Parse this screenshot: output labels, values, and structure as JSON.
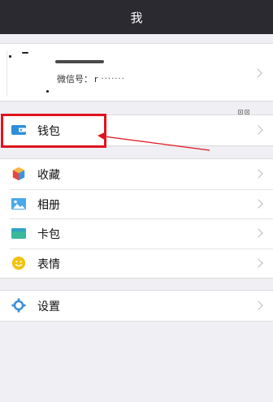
{
  "header": {
    "title": "我"
  },
  "profile": {
    "wechat_id_label": "微信号：",
    "wechat_id_value": "r",
    "wechat_id_masked": "·······"
  },
  "groups": [
    {
      "items": [
        {
          "label": "钱包",
          "icon": "wallet-icon"
        }
      ]
    },
    {
      "items": [
        {
          "label": "收藏",
          "icon": "favorites-cube-icon"
        },
        {
          "label": "相册",
          "icon": "album-picture-icon"
        },
        {
          "label": "卡包",
          "icon": "card-pack-icon"
        },
        {
          "label": "表情",
          "icon": "emoji-face-icon"
        }
      ]
    },
    {
      "items": [
        {
          "label": "设置",
          "icon": "settings-gear-icon"
        }
      ]
    }
  ],
  "colors": {
    "titlebar": "#2b2a30",
    "background": "#efeff4",
    "highlight": "#e0141e",
    "wallet": "#2f8fd8",
    "favorites_red": "#e8453c",
    "favorites_yellow": "#f6b73c",
    "favorites_blue": "#3a93e0",
    "album": "#4aa8e8",
    "card_green": "#39b89a",
    "emoji": "#f4c20d",
    "settings": "#3a8fd8"
  }
}
